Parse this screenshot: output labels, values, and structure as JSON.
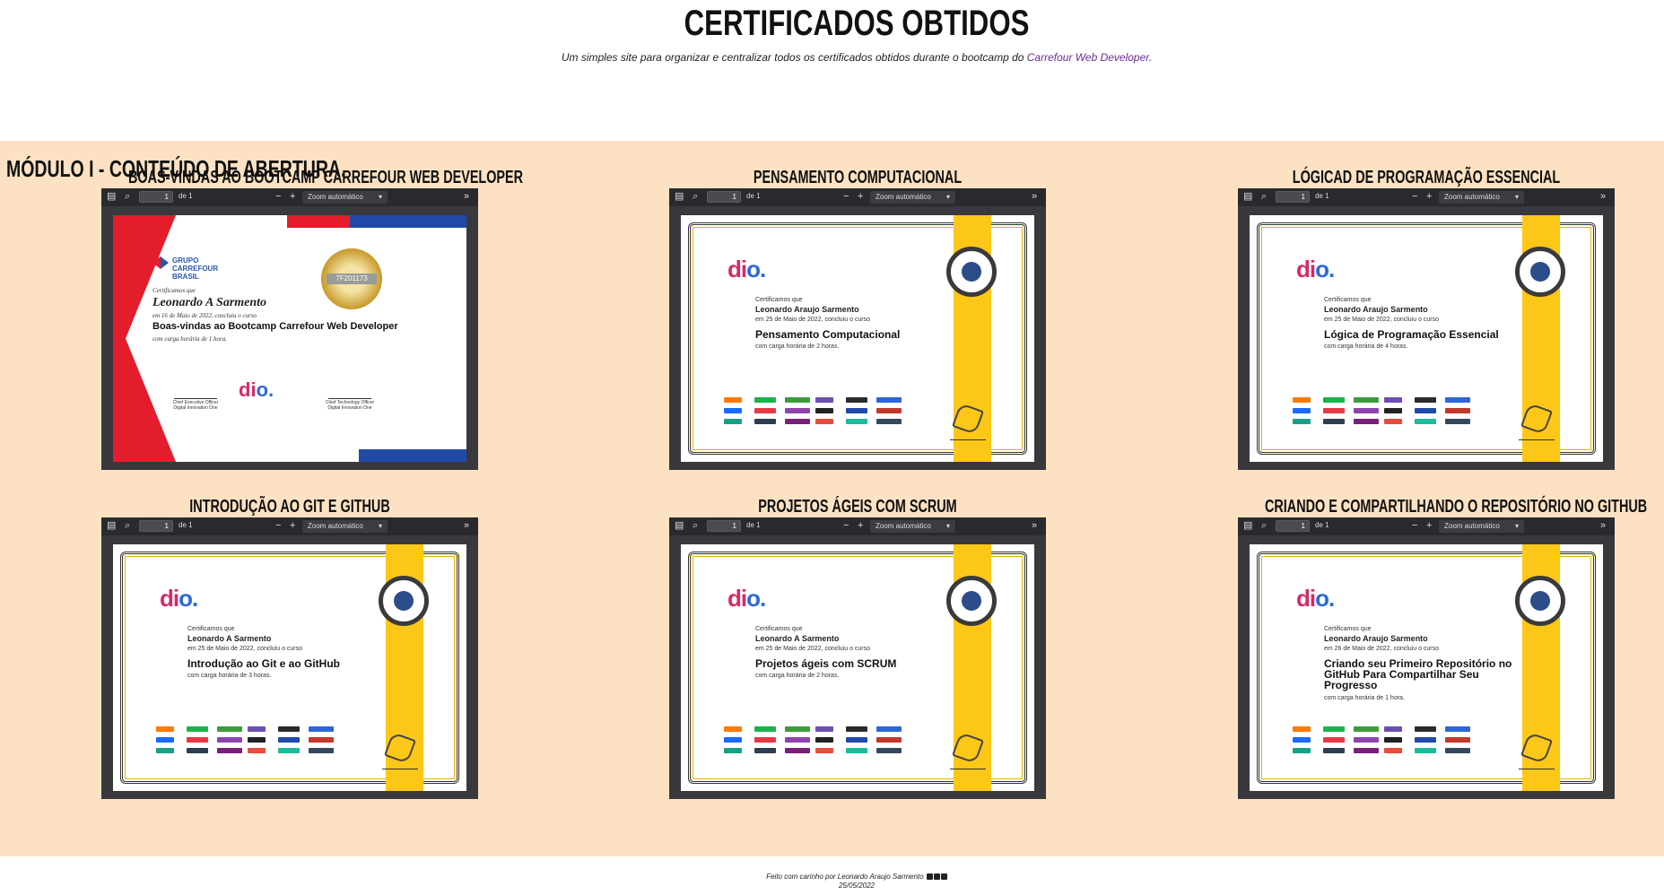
{
  "header": {
    "title": "CERTIFICADOS OBTIDOS",
    "subtitle": "Um simples site para organizar e centralizar todos os certificados obtidos durante o bootcamp do ",
    "subtitle_link": "Carrefour Web Developer",
    "subtitle_end": "."
  },
  "module": {
    "title": "MÓDULO I - CONTEÚDO DE ABERTURA."
  },
  "viewer": {
    "page_value": "1",
    "page_of": "de 1",
    "zoom": "Zoom automático"
  },
  "certificates": [
    {
      "title": "BOAS-VINDAS AO BOOTCAMP CARREFOUR WEB DEVELOPER",
      "logo_line1": "GRUPO",
      "logo_line2": "CARREFOUR",
      "logo_line3": "BRASIL",
      "badge_code": "7F201173",
      "certify": "Certificamos que",
      "name": "Leonardo A Sarmento",
      "date": "em 16 de Maio de 2022, concluiu o curso",
      "course": "Boas-vindas ao Bootcamp Carrefour Web Developer",
      "hours": "com carga horária de 1 hora.",
      "sig_left": "Chief Executive Officer Digital Innovation One",
      "sig_right": "Chief Technology Officer Digital Innovation One"
    },
    {
      "title": "PENSAMENTO COMPUTACIONAL",
      "certify": "Certificamos que",
      "name": "Leonardo Araujo Sarmento",
      "date": "em 25 de Maio de 2022, concluiu o curso",
      "course": "Pensamento Computacional",
      "hours": "com carga horária de 2 horas."
    },
    {
      "title": "LÓGICAD DE PROGRAMAÇÃO ESSENCIAL",
      "certify": "Certificamos que",
      "name": "Leonardo Araujo Sarmento",
      "date": "em 25 de Maio de 2022, concluiu o curso",
      "course": "Lógica de Programação Essencial",
      "hours": "com carga horária de 4 horas."
    },
    {
      "title": "INTRODUÇÃO AO GIT E GITHUB",
      "certify": "Certificamos que",
      "name": "Leonardo A Sarmento",
      "date": "em 25 de Maio de 2022, concluiu o curso",
      "course": "Introdução ao Git e ao GitHub",
      "hours": "com carga horária de 3 horas."
    },
    {
      "title": "PROJETOS ÁGEIS COM SCRUM",
      "certify": "Certificamos que",
      "name": "Leonardo A Sarmento",
      "date": "em 25 de Maio de 2022, concluiu o curso",
      "course": "Projetos ágeis com SCRUM",
      "hours": "com carga horária de 2 horas."
    },
    {
      "title": "CRIANDO E COMPARTILHANDO O REPOSITÓRIO NO GITHUB",
      "certify": "Certificamos que",
      "name": "Leonardo Araujo Sarmento",
      "date": "em 26 de Maio de 2022, concluiu o curso",
      "course": "Criando seu Primeiro Repositório no GitHub Para Compartilhar Seu Progresso",
      "hours": "com carga horária de 1 hora."
    }
  ],
  "dio_logo": {
    "part1": "di",
    "part2": "o."
  },
  "footer": {
    "line1": "Feito com carinho por Leonardo Araujo Sarmento",
    "line2": "25/05/2022"
  },
  "colors": {
    "band": "#fce2c3",
    "link": "#6a2c91",
    "viewer": "#38383d",
    "ribbon": "#fdc717"
  }
}
